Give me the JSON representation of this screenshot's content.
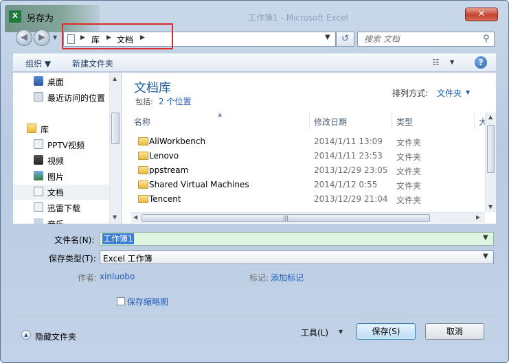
{
  "window": {
    "title": "另存为",
    "background_title": "工作簿1 - Microsoft Excel",
    "close_label": "✕",
    "icon_letters": "X"
  },
  "address": {
    "breadcrumbs": [
      "库",
      "文档"
    ],
    "search_placeholder": "搜索 文档"
  },
  "toolbar": {
    "organize_label": "组织 ▼",
    "new_folder_label": "新建文件夹"
  },
  "nav_pane": {
    "items": [
      {
        "label": "桌面"
      },
      {
        "label": "最近访问的位置"
      },
      {
        "label": "库"
      },
      {
        "label": "PPTV视频"
      },
      {
        "label": "视频"
      },
      {
        "label": "图片"
      },
      {
        "label": "文档"
      },
      {
        "label": "迅雷下载"
      },
      {
        "label": "音乐"
      }
    ]
  },
  "content": {
    "library_title": "文档库",
    "includes_label": "包括:",
    "includes_link": "2 个位置",
    "sort_label": "排列方式:",
    "sort_value": "文件夹",
    "columns": {
      "name": "名称",
      "modified": "修改日期",
      "type": "类型",
      "size": "大"
    },
    "rows": [
      {
        "name": "AliWorkbench",
        "modified": "2014/1/11 13:09",
        "type": "文件夹"
      },
      {
        "name": "Lenovo",
        "modified": "2014/1/11 23:53",
        "type": "文件夹"
      },
      {
        "name": "ppstream",
        "modified": "2013/12/29 23:05",
        "type": "文件夹"
      },
      {
        "name": "Shared Virtual Machines",
        "modified": "2014/1/12 0:55",
        "type": "文件夹"
      },
      {
        "name": "Tencent",
        "modified": "2013/12/29 21:04",
        "type": "文件夹"
      }
    ]
  },
  "form": {
    "filename_label": "文件名(N):",
    "filename_value": "工作簿1",
    "filetype_label": "保存类型(T):",
    "filetype_value": "Excel 工作簿",
    "author_label": "作者:",
    "author_value": "xinluobo",
    "tags_label": "标记:",
    "tags_value": "添加标记",
    "thumbnail_label": "保存缩略图"
  },
  "footer": {
    "hide_folders_label": "隐藏文件夹",
    "tools_label": "工具(L)",
    "save_label": "保存(S)",
    "cancel_label": "取消"
  },
  "colors": {
    "accent_blue": "#1e5ab6",
    "library_title": "#1e5a9e",
    "highlight_box": "#e02a2a",
    "filename_bg": "#dff4e1"
  }
}
